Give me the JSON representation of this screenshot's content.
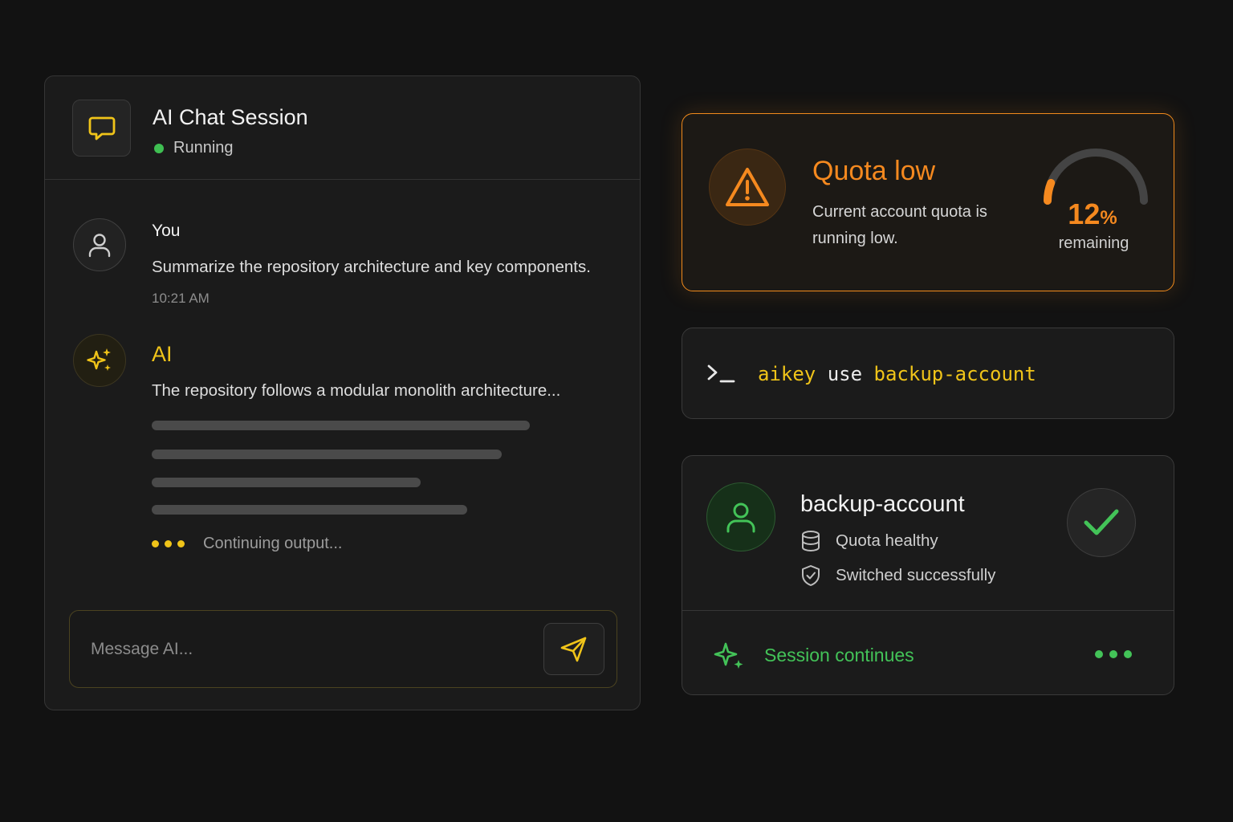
{
  "chat": {
    "title": "AI Chat Session",
    "status": "Running",
    "messages": {
      "user": {
        "author": "You",
        "text": "Summarize the repository architecture and key components.",
        "time": "10:21 AM"
      },
      "ai": {
        "author": "AI",
        "text": "The repository follows a modular monolith architecture..."
      }
    },
    "typing_text": "Continuing output...",
    "input_placeholder": "Message AI...",
    "accent_color": "#f0c419"
  },
  "quota": {
    "title": "Quota low",
    "description": "Current account quota is running low.",
    "value": "12",
    "unit": "%",
    "label": "remaining",
    "remaining_fraction": 0.12,
    "accent_color": "#f5891f"
  },
  "terminal": {
    "cmd_name": "aikey",
    "cmd_verb": "use",
    "cmd_arg": "backup-account"
  },
  "account": {
    "name": "backup-account",
    "quota_status": "Quota healthy",
    "switch_status": "Switched successfully",
    "session_text": "Session continues",
    "accent_color": "#43c358"
  },
  "icons": {
    "chat_header": "chat-bubble-icon",
    "user_avatar": "user-icon",
    "ai_avatar": "sparkle-icon",
    "send": "send-icon",
    "warning": "warning-triangle-icon",
    "terminal": "terminal-prompt-icon",
    "account": "user-icon",
    "database": "database-icon",
    "shield": "shield-check-icon",
    "check": "check-icon",
    "session": "sparkle-icon",
    "more": "more-dots-icon"
  }
}
